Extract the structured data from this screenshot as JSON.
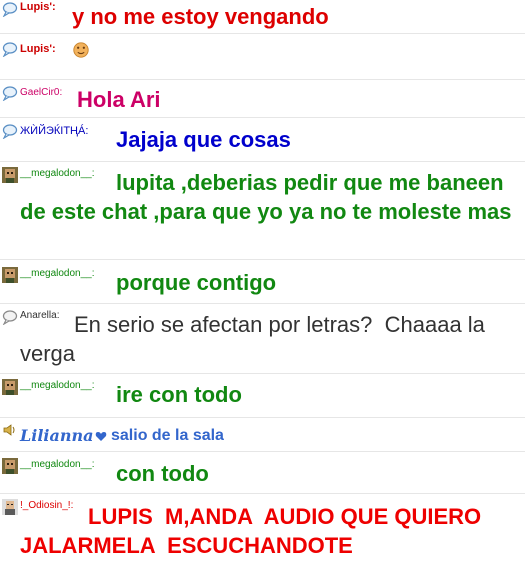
{
  "messages": [
    {
      "user": "Lupis':",
      "user_color": "#cc0000",
      "text": "y no me estoy vengando",
      "text_color": "#dd0000",
      "avatar": "speech-bubble-icon"
    },
    {
      "user": "Lupis':",
      "user_color": "#cc0000",
      "text": "",
      "text_color": "#dd0000",
      "avatar": "speech-bubble-icon",
      "emoji": "cookie-face-emoji"
    },
    {
      "user": "GaelCir0:",
      "user_color": "#cc0066",
      "text": "Hola Ari",
      "text_color": "#cc0066",
      "avatar": "speech-bubble-icon"
    },
    {
      "user": "ЖЍЙЭЌΙТҢÁ:",
      "user_color": "#0000bb",
      "text": "Jajaja que cosas",
      "text_color": "#0000cc",
      "avatar": "speech-bubble-icon"
    },
    {
      "user": "__megalodon__:",
      "user_color": "#118811",
      "text": "lupita ,deberias pedir que me baneen de este chat ,para que yo ya no te moleste mas",
      "text_color": "#118811",
      "avatar": "user-photo-icon"
    },
    {
      "user": "__megalodon__:",
      "user_color": "#118811",
      "text": "porque contigo",
      "text_color": "#118811",
      "avatar": "user-photo-icon"
    },
    {
      "user": "Anarella:",
      "user_color": "#333333",
      "text": "En serio se afectan por letras?  Chaaaa la verga",
      "text_color": "#333333",
      "avatar": "speech-bubble-icon"
    },
    {
      "user": "__megalodon__:",
      "user_color": "#118811",
      "text": "ire con todo",
      "text_color": "#118811",
      "avatar": "user-photo-icon"
    },
    {
      "system": true,
      "user": "Lilianna",
      "text": "salio de la sala",
      "text_color": "#3366cc",
      "avatar": "speaker-icon"
    },
    {
      "user": "__megalodon__:",
      "user_color": "#118811",
      "text": "con todo",
      "text_color": "#118811",
      "avatar": "user-photo-icon"
    },
    {
      "user": "!_Odiosin_!:",
      "user_color": "#dd0000",
      "text": "LUPIS  M,ANDA  AUDIO QUE QUIERO JALARMELA  ESCUCHANDOTE",
      "text_color": "#ee0000",
      "avatar": "user-photo-icon"
    }
  ]
}
